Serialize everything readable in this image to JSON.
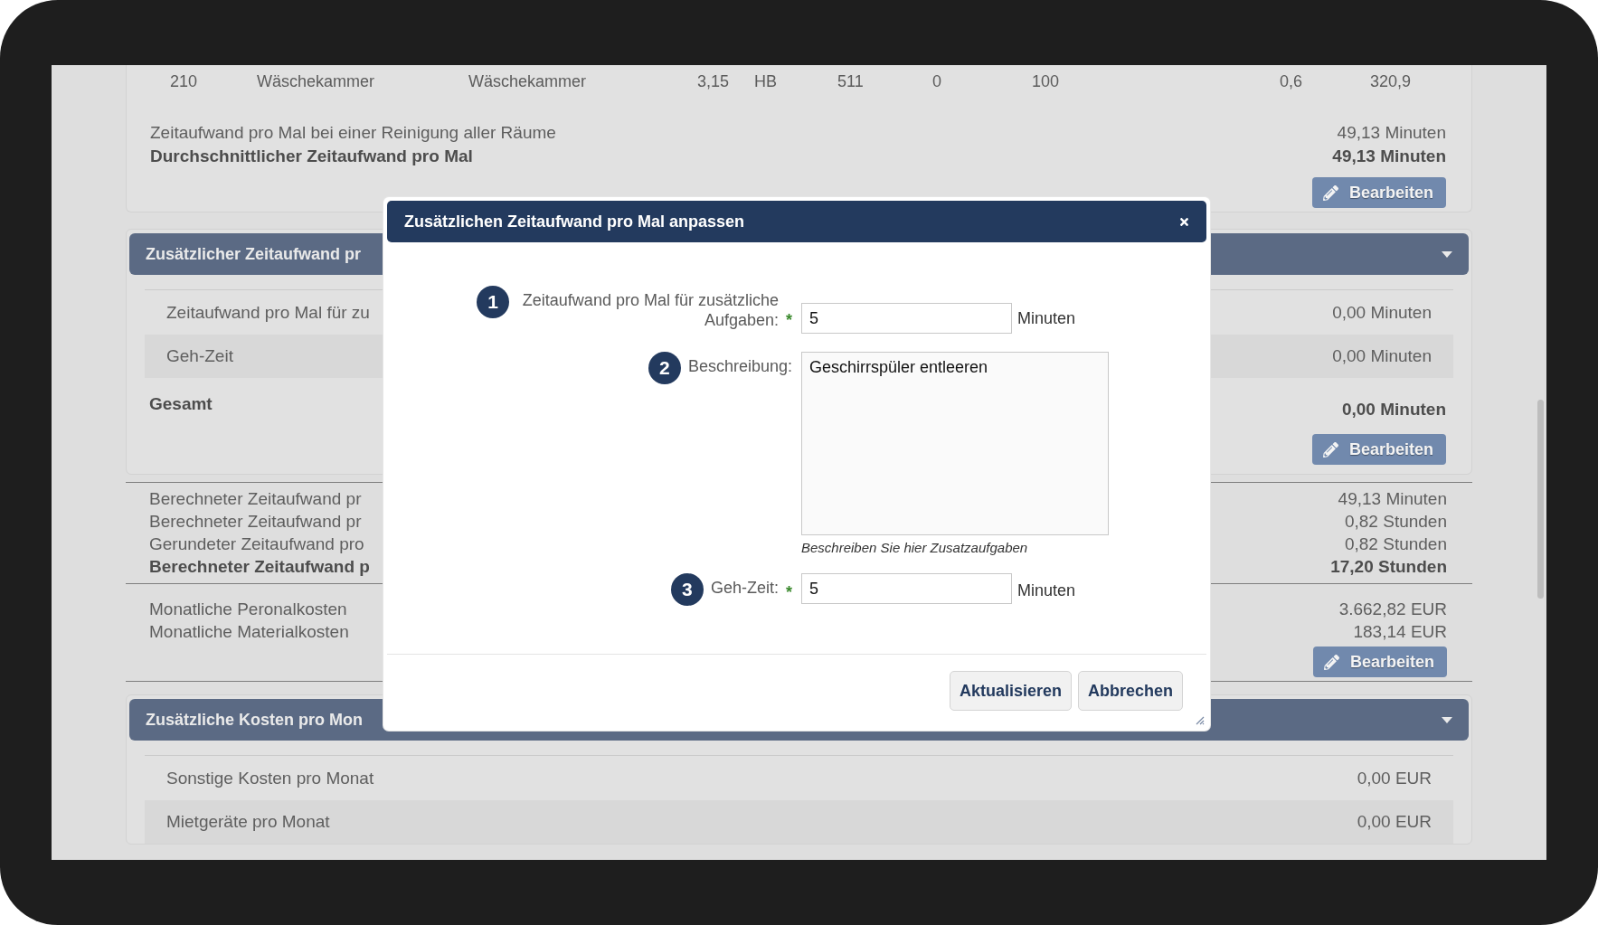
{
  "table_row": [
    "210",
    "Wäschekammer",
    "Wäschekammer",
    "3,15",
    "HB",
    "511",
    "0",
    "100",
    "0,6",
    "320,9"
  ],
  "summary": {
    "lines": [
      {
        "label": "Zeitaufwand pro Mal bei einer Reinigung aller Räume",
        "value": "49,13 Minuten",
        "bold": false
      },
      {
        "label": "Durchschnittlicher Zeitaufwand pro Mal",
        "value": "49,13 Minuten",
        "bold": true
      }
    ],
    "button": "Bearbeiten"
  },
  "time_section": {
    "title": "Zusätzlicher Zeitaufwand pr",
    "rows": [
      {
        "label": "Zeitaufwand pro Mal für zu",
        "value": "0,00 Minuten"
      },
      {
        "label": "Geh-Zeit",
        "value": "0,00 Minuten"
      }
    ],
    "total": {
      "label": "Gesamt",
      "value": "0,00 Minuten"
    },
    "button": "Bearbeiten"
  },
  "calculation": {
    "lines": [
      {
        "label": "Berechneter Zeitaufwand pr",
        "value": "49,13 Minuten",
        "bold": false
      },
      {
        "label": "Berechneter Zeitaufwand pr",
        "value": "0,82 Stunden",
        "bold": false
      },
      {
        "label": "Gerundeter Zeitaufwand pro",
        "value": "0,82 Stunden",
        "bold": false
      },
      {
        "label": "Berechneter Zeitaufwand p",
        "value": "17,20 Stunden",
        "bold": true
      }
    ]
  },
  "monthly": {
    "lines": [
      {
        "label": "Monatliche Peronalkosten",
        "value": "3.662,82 EUR",
        "bold": false
      },
      {
        "label": "Monatliche Materialkosten",
        "value": "183,14 EUR",
        "bold": false
      }
    ],
    "button": "Bearbeiten"
  },
  "cost_section": {
    "title": "Zusätzliche Kosten pro Mon",
    "rows": [
      {
        "label": "Sonstige Kosten pro Monat",
        "value": "0,00 EUR"
      },
      {
        "label": "Mietgeräte pro Monat",
        "value": "0,00 EUR"
      }
    ]
  },
  "dialog": {
    "title": "Zusätzlichen Zeitaufwand pro Mal anpassen",
    "fields": [
      {
        "kind": "input",
        "number": "1",
        "label": "Zeitaufwand pro Mal für zusätzliche Aufgaben:",
        "required_mark": "*",
        "value": "5",
        "unit": "Minuten"
      },
      {
        "kind": "textarea",
        "number": "2",
        "label": "Beschreibung:",
        "value": "Geschirrspüler entleeren",
        "hint": "Beschreiben Sie hier Zusatzaufgaben"
      },
      {
        "kind": "input",
        "number": "3",
        "label": "Geh-Zeit:",
        "required_mark": "*",
        "value": "5",
        "unit": "Minuten"
      }
    ],
    "buttons": [
      "Aktualisieren",
      "Abbrechen"
    ]
  }
}
